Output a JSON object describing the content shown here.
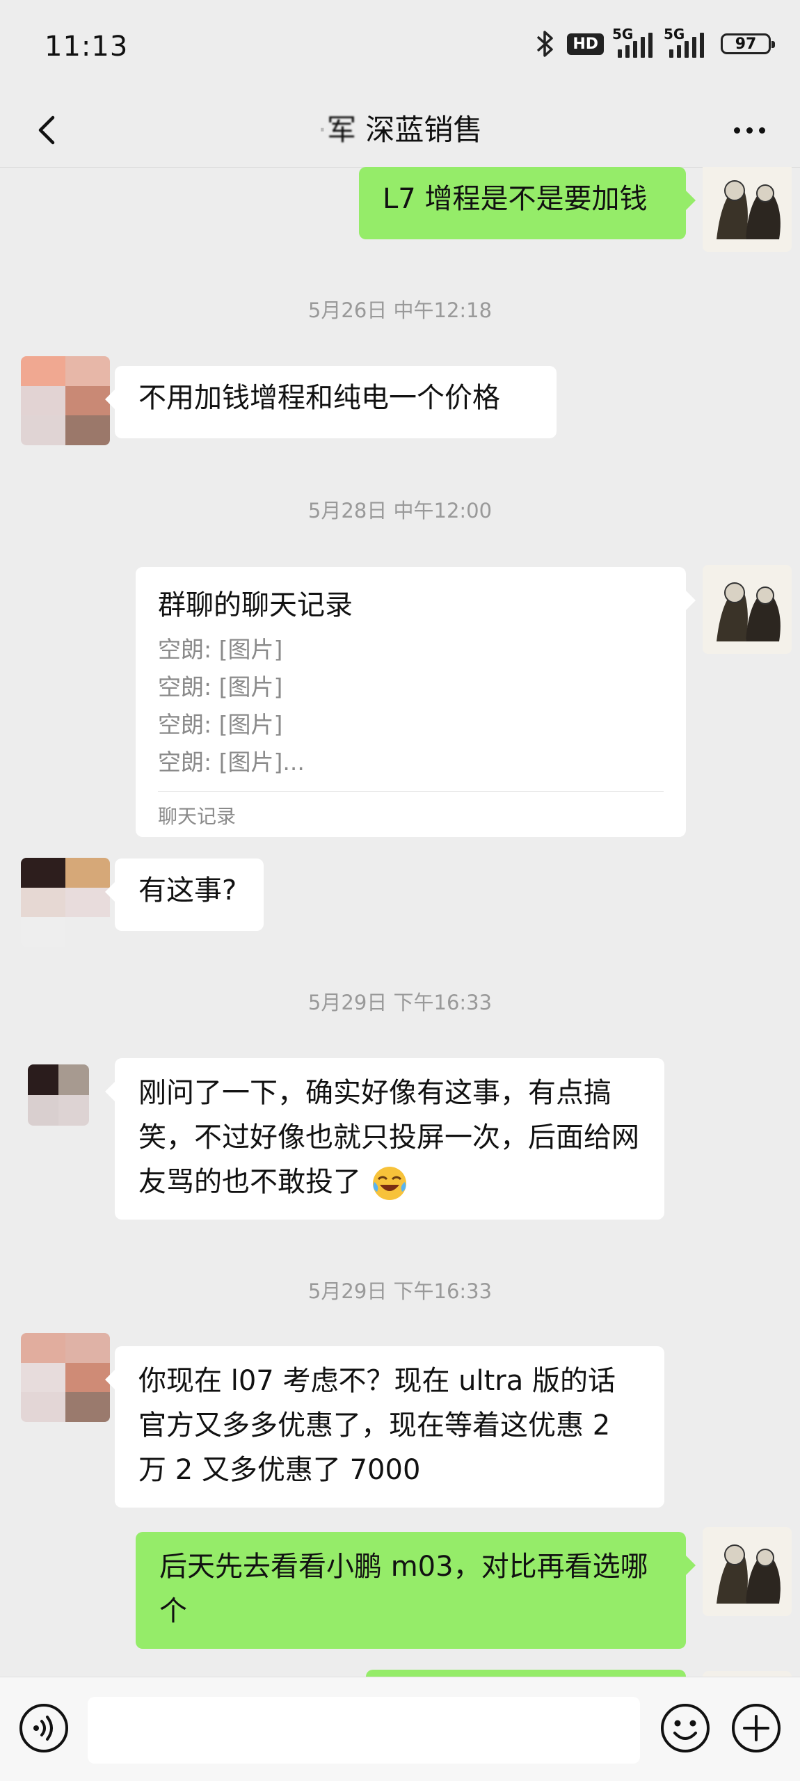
{
  "status_bar": {
    "time": "11:13",
    "hd_label": "HD",
    "net1": "5G",
    "net2": "5G",
    "battery": "97"
  },
  "header": {
    "title": "深蓝销售",
    "title_prefix_obscured": "军",
    "back_icon": "chevron-left-icon",
    "more_icon": "more-dots-icon"
  },
  "messages": {
    "m1": {
      "text": "L7 增程是不是要加钱"
    },
    "ts1": "5月26日 中午12:18",
    "m2": {
      "text": "不用加钱增程和纯电一个价格"
    },
    "ts2": "5月28日 中午12:00",
    "m3": {
      "title": "群聊的聊天记录",
      "lines": [
        "空朗: [图片]",
        "空朗: [图片]",
        "空朗: [图片]",
        "空朗: [图片]..."
      ],
      "footer": "聊天记录"
    },
    "m4": {
      "text": "有这事?"
    },
    "ts3": "5月29日 下午16:33",
    "m5": {
      "text": "刚问了一下，确实好像有这事，有点搞笑，不过好像也就只投屏一次，后面给网友骂的也不敢投了"
    },
    "ts4": "5月29日 下午16:33",
    "m6": {
      "text": "你现在 l07 考虑不？现在 ultra 版的话官方又多多优惠了，现在等着这优惠 2 万 2 又多优惠了 7000"
    },
    "m7": {
      "text": "后天先去看看小鹏 m03，对比再看选哪个"
    }
  },
  "input_bar": {
    "placeholder": "",
    "voice_icon": "voice-icon",
    "emoji_icon": "emoji-icon",
    "plus_icon": "plus-icon"
  },
  "colors": {
    "out_bubble": "#95ec69",
    "in_bubble": "#ffffff",
    "background": "#ededed"
  }
}
